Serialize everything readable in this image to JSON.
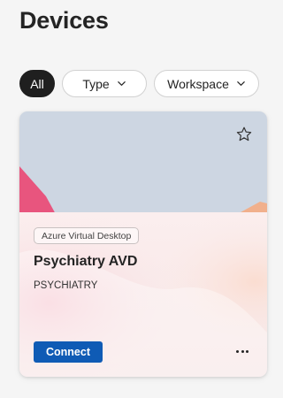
{
  "page": {
    "title": "Devices"
  },
  "filters": {
    "all_label": "All",
    "type_label": "Type",
    "workspace_label": "Workspace"
  },
  "device_card": {
    "badge": "Azure Virtual Desktop",
    "name": "Psychiatry AVD",
    "workspace": "PSYCHIATRY",
    "connect_label": "Connect",
    "favorite_icon": "star-outline-icon",
    "more_icon": "more-horizontal-icon"
  },
  "colors": {
    "connect_button": "#0f5bb5",
    "active_chip": "#1f1f1f",
    "card_top": "#cdd6e2",
    "accent_pink": "#e8517a"
  }
}
